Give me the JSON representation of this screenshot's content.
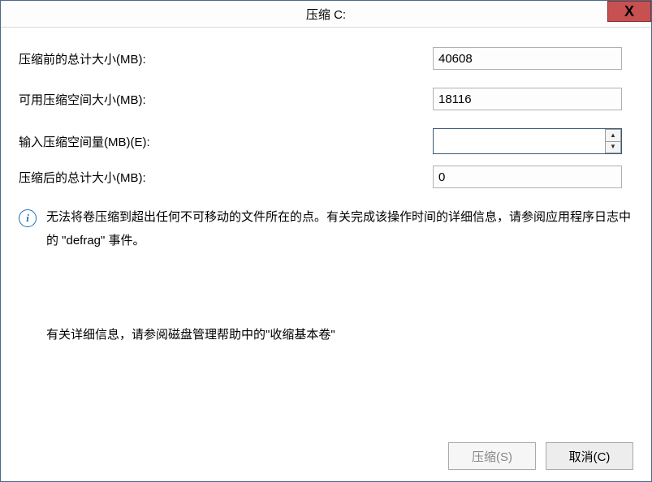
{
  "window": {
    "title": "压缩 C:",
    "close_glyph": "X"
  },
  "form": {
    "total_before_label": "压缩前的总计大小(MB):",
    "total_before_value": "40608",
    "available_label": "可用压缩空间大小(MB):",
    "available_value": "18116",
    "input_amount_label": "输入压缩空间量(MB)(E):",
    "input_amount_value": "",
    "total_after_label": "压缩后的总计大小(MB):",
    "total_after_value": "0"
  },
  "info": {
    "icon_glyph": "i",
    "primary": "无法将卷压缩到超出任何不可移动的文件所在的点。有关完成该操作时间的详细信息，请参阅应用程序日志中的 \"defrag\" 事件。",
    "secondary": "有关详细信息，请参阅磁盘管理帮助中的\"收缩基本卷\""
  },
  "buttons": {
    "shrink": "压缩(S)",
    "cancel": "取消(C)"
  }
}
